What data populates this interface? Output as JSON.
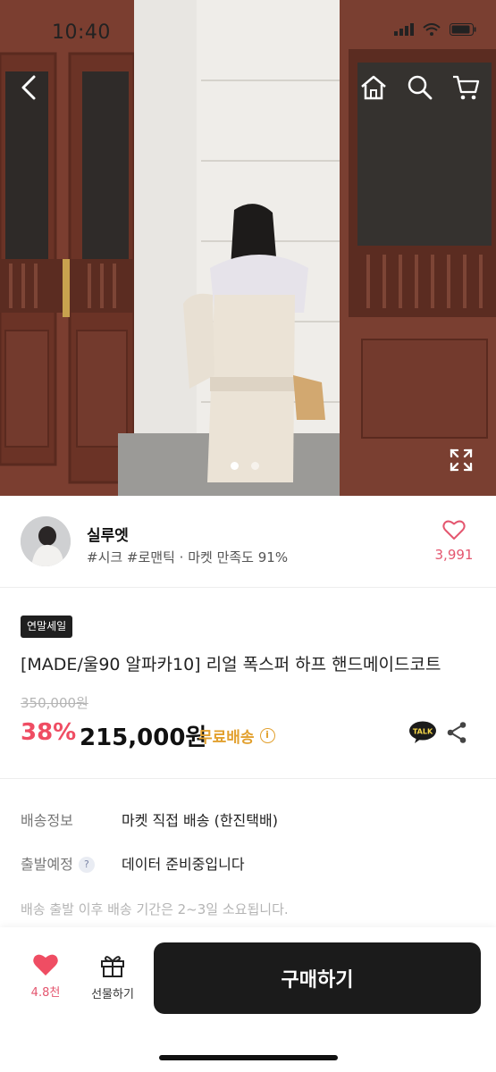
{
  "status_bar": {
    "time": "10:40"
  },
  "header": {
    "back_icon": "chevron-left-icon",
    "home_icon": "home-icon",
    "search_icon": "search-icon",
    "cart_icon": "cart-icon"
  },
  "gallery": {
    "page_count": 2,
    "active_index": 0,
    "expand_icon": "expand-icon"
  },
  "seller": {
    "name": "실루엣",
    "tags": "#시크 #로맨틱 · 마켓 만족도 91%",
    "like_count": "3,991",
    "accent": "#e4566f"
  },
  "product": {
    "badge": "연말세일",
    "title": "[MADE/울90 알파카10] 리얼 폭스퍼 하프 핸드메이드코트",
    "original_price": "350,000원",
    "discount": "38%",
    "price": "215,000원",
    "free_shipping": "무료배송",
    "talk_label": "TALK",
    "colors": {
      "discount": "#ef4d63",
      "free_shipping": "#e2a02e"
    }
  },
  "shipping": {
    "info_label": "배송정보",
    "info_value": "마켓 직접 배송 (한진택배)",
    "departure_label": "출발예정",
    "departure_value": "데이터 준비중입니다",
    "note": "배송 출발 이후 배송 기간은 2~3일 소요됩니다."
  },
  "bottom_bar": {
    "wish_count": "4.8천",
    "gift_label": "선물하기",
    "buy_label": "구매하기"
  }
}
